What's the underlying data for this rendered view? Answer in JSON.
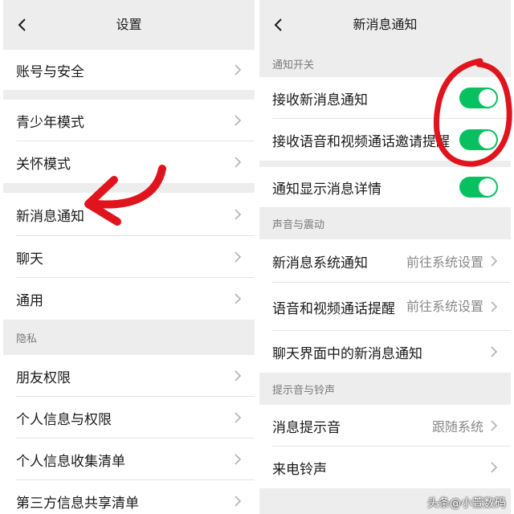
{
  "left_panel": {
    "title": "设置",
    "account": "账号与安全",
    "teen_mode": "青少年模式",
    "care_mode": "关怀模式",
    "new_msg": "新消息通知",
    "chat": "聊天",
    "general": "通用",
    "privacy_section": "隐私",
    "friend_perm": "朋友权限",
    "personal_info": "个人信息与权限",
    "collect_list": "个人信息收集清单",
    "third_party": "第三方信息共享清单"
  },
  "right_panel": {
    "title": "新消息通知",
    "section_notify": "通知开关",
    "receive_new": "接收新消息通知",
    "receive_new_on": true,
    "receive_call": "接收语音和视频通话邀请提醒",
    "receive_call_on": true,
    "show_detail": "通知显示消息详情",
    "show_detail_on": true,
    "section_sound": "声音与震动",
    "system_notify": "新消息系统通知",
    "system_notify_value": "前往系统设置",
    "call_reminder": "语音和视频通话提醒",
    "call_reminder_value": "前往系统设置",
    "chat_notify": "聊天界面中的新消息通知",
    "section_tone": "提示音与铃声",
    "msg_tone": "消息提示音",
    "msg_tone_value": "跟随系统",
    "ringtone": "来电铃声"
  },
  "annotation_colors": {
    "arrow": "#e0141c",
    "circle": "#e0141c",
    "toggle_on": "#07c160"
  },
  "watermark": "头条@小萱数码"
}
